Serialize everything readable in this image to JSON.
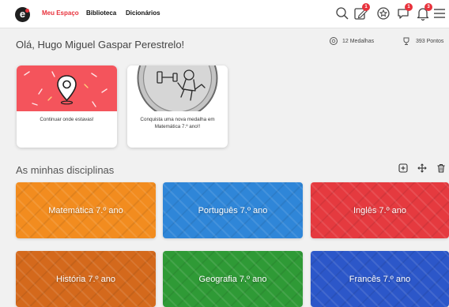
{
  "topbar": {
    "logo_letter": "e",
    "nav": [
      "Meu Espaço",
      "Biblioteca",
      "Dicionários"
    ],
    "active_color": "#e8323c",
    "icons": [
      {
        "name": "search-icon"
      },
      {
        "name": "edit-notes-icon",
        "badge": "1"
      },
      {
        "name": "medal-icon"
      },
      {
        "name": "chat-icon",
        "badge": "1"
      },
      {
        "name": "notifications-bell-icon",
        "badge": "3"
      },
      {
        "name": "menu-icon"
      }
    ]
  },
  "greeting": "Olá, Hugo Miguel Gaspar Perestrelo!",
  "stats": {
    "medals": "12 Medalhas",
    "points": "393 Pontos"
  },
  "cards": [
    {
      "caption": "Continuar onde estavas!",
      "art": "location-pin-icon",
      "color": "#f4545c"
    },
    {
      "caption": "Conquista uma nova medalha em Matemática 7.º ano!!",
      "art": "weightlifter-medal-illustration",
      "color": "#c4c4c4"
    }
  ],
  "section": {
    "title": "As minhas disciplinas",
    "actions": [
      "add-icon",
      "move-icon",
      "delete-icon"
    ]
  },
  "subjects": [
    {
      "label": "Matemática 7.º ano",
      "color": "#f28c1f"
    },
    {
      "label": "Português 7.º ano",
      "color": "#2f86d8"
    },
    {
      "label": "Inglês 7.º ano",
      "color": "#e53a3f"
    },
    {
      "label": "História 7.º ano",
      "color": "#d4691c"
    },
    {
      "label": "Geografia 7.º ano",
      "color": "#2f9a36"
    },
    {
      "label": "Francês 7.º ano",
      "color": "#2c57c9"
    }
  ]
}
